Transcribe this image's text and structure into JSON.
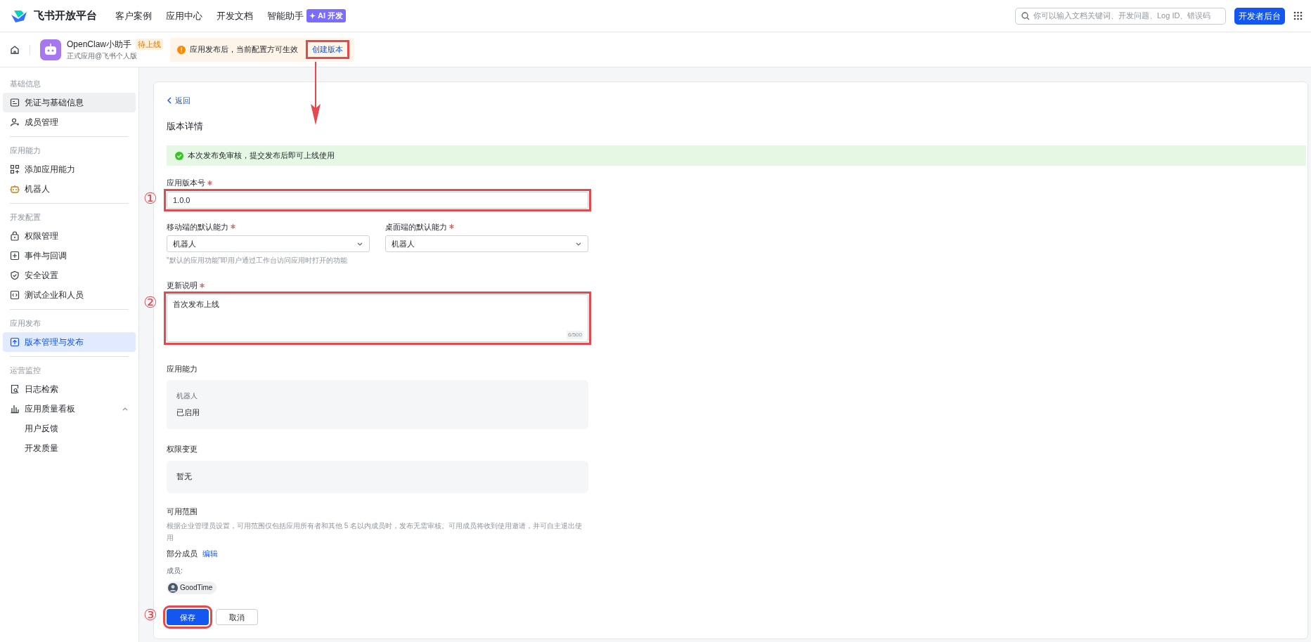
{
  "header": {
    "logo_text": "飞书开放平台",
    "nav": [
      {
        "label": "客户案例"
      },
      {
        "label": "应用中心"
      },
      {
        "label": "开发文档"
      },
      {
        "label": "智能助手",
        "badge": "AI 开发"
      }
    ],
    "search": {
      "placeholder": "你可以输入文档关键词、开发问题、Log ID、错误码"
    },
    "console_button": "开发者后台"
  },
  "app_bar": {
    "app_name": "OpenClaw小助手",
    "status_badge": "待上线",
    "subtitle": "正式应用@飞书个人版",
    "notice": {
      "text": "应用发布后，当前配置方可生效",
      "link": "创建版本",
      "highlighted": true,
      "callout_arrow": true
    }
  },
  "sidebar": {
    "sections": [
      {
        "title": "基础信息",
        "items": [
          {
            "label": "凭证与基础信息",
            "selected": false,
            "hovered": true
          },
          {
            "label": "成员管理",
            "selected": false,
            "hovered": false
          }
        ]
      },
      {
        "title": "应用能力",
        "items": [
          {
            "label": "添加应用能力",
            "selected": false,
            "hovered": false
          },
          {
            "label": "机器人",
            "selected": false,
            "hovered": false
          }
        ]
      },
      {
        "title": "开发配置",
        "items": [
          {
            "label": "权限管理",
            "selected": false,
            "hovered": false
          },
          {
            "label": "事件与回调",
            "selected": false,
            "hovered": false
          },
          {
            "label": "安全设置",
            "selected": false,
            "hovered": false
          },
          {
            "label": "测试企业和人员",
            "selected": false,
            "hovered": false
          }
        ]
      },
      {
        "title": "应用发布",
        "items": [
          {
            "label": "版本管理与发布",
            "selected": true,
            "hovered": false
          }
        ]
      },
      {
        "title": "运营监控",
        "items": [
          {
            "label": "日志检索",
            "selected": false,
            "hovered": false
          },
          {
            "label": "应用质量看板",
            "selected": false,
            "hovered": false,
            "expanded": true,
            "children": [
              {
                "label": "用户反馈",
                "selected": false,
                "hovered": false
              },
              {
                "label": "开发质量",
                "selected": false,
                "hovered": false
              }
            ]
          }
        ]
      }
    ]
  },
  "content": {
    "back_link": "返回",
    "title": "版本详情",
    "alert": "本次发布免审核，提交发布后即可上线使用",
    "version": {
      "label": "应用版本号",
      "required": true,
      "value": "1.0.0",
      "highlighted": true,
      "marker": "①"
    },
    "defaults": [
      {
        "label": "移动端的默认能力",
        "required": true,
        "value": "机器人"
      },
      {
        "label": "桌面端的默认能力",
        "required": true,
        "value": "机器人"
      }
    ],
    "default_hint": "\"默认的应用功能\"即用户通过工作台访问应用时打开的功能",
    "notes": {
      "label": "更新说明",
      "required": true,
      "value": "首次发布上线",
      "counter": "6/500",
      "highlighted": true,
      "marker": "②"
    },
    "capabilities": {
      "label": "应用能力",
      "name": "机器人",
      "status": "已启用"
    },
    "permissions": {
      "label": "权限变更",
      "value": "暂无"
    },
    "scope": {
      "label": "可用范围",
      "description": "根据企业管理员设置，可用范围仅包括应用所有者和其他 5 名以内成员时，发布无需审核。可用成员将收到使用邀请，并可自主退出使用",
      "mode": "部分成员",
      "edit_link": "编辑",
      "members_label": "成员:",
      "members": [
        {
          "name": "GoodTime"
        }
      ]
    },
    "actions": [
      {
        "label": "保存",
        "kind": "primary",
        "highlighted": true,
        "marker": "③"
      },
      {
        "label": "取消",
        "kind": "secondary",
        "highlighted": false
      }
    ]
  }
}
